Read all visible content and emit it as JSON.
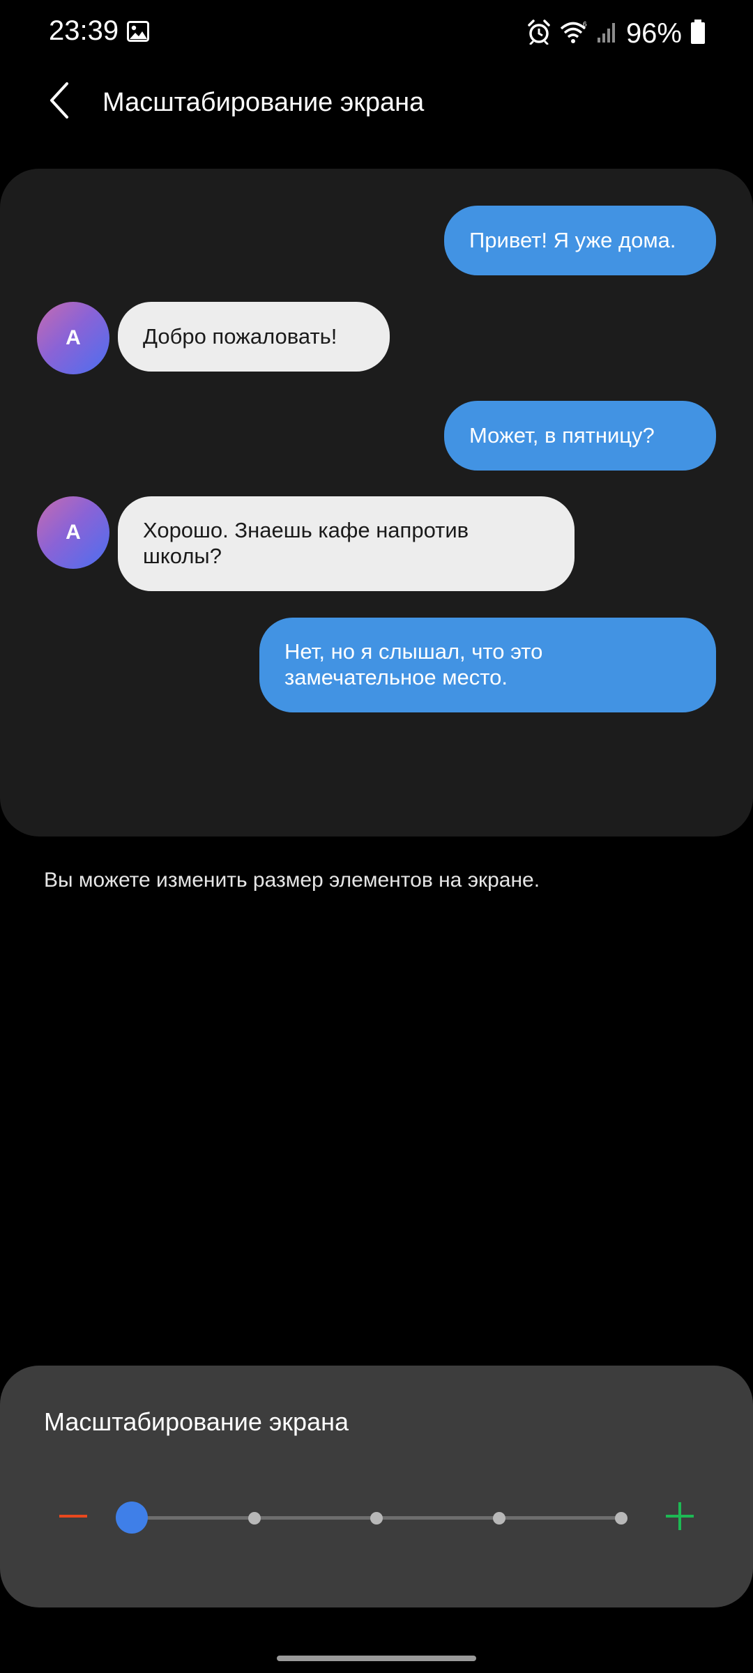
{
  "status_bar": {
    "time": "23:39",
    "battery_percent": "96%",
    "icons": [
      "gallery-icon",
      "alarm-icon",
      "wifi-icon",
      "signal-icon",
      "battery-icon"
    ]
  },
  "app_bar": {
    "title": "Масштабирование экрана",
    "back_icon": "chevron-left-icon"
  },
  "preview": {
    "messages": [
      {
        "direction": "out",
        "text": "Привет! Я уже дома."
      },
      {
        "direction": "in",
        "avatar": "A",
        "text": "Добро пожаловать!"
      },
      {
        "direction": "out",
        "text": "Может, в пятницу?"
      },
      {
        "direction": "in",
        "avatar": "A",
        "text": "Хорошо. Знаешь кафе напротив школы?"
      },
      {
        "direction": "out",
        "text": "Нет, но я слышал, что это замечательное место."
      }
    ]
  },
  "description": "Вы можете изменить размер элементов на экране.",
  "zoom_panel": {
    "title": "Масштабирование экрана",
    "minus_icon": "minus-icon",
    "plus_icon": "plus-icon",
    "steps": 5,
    "selected_step": 1,
    "colors": {
      "minus": "#e8481e",
      "plus": "#1db954",
      "thumb": "#3f7fe8"
    }
  },
  "colors": {
    "outgoing_bubble": "#4293e3",
    "incoming_bubble": "#ededed",
    "background": "#000000",
    "card": "#1c1c1c",
    "panel": "#3d3d3d"
  }
}
